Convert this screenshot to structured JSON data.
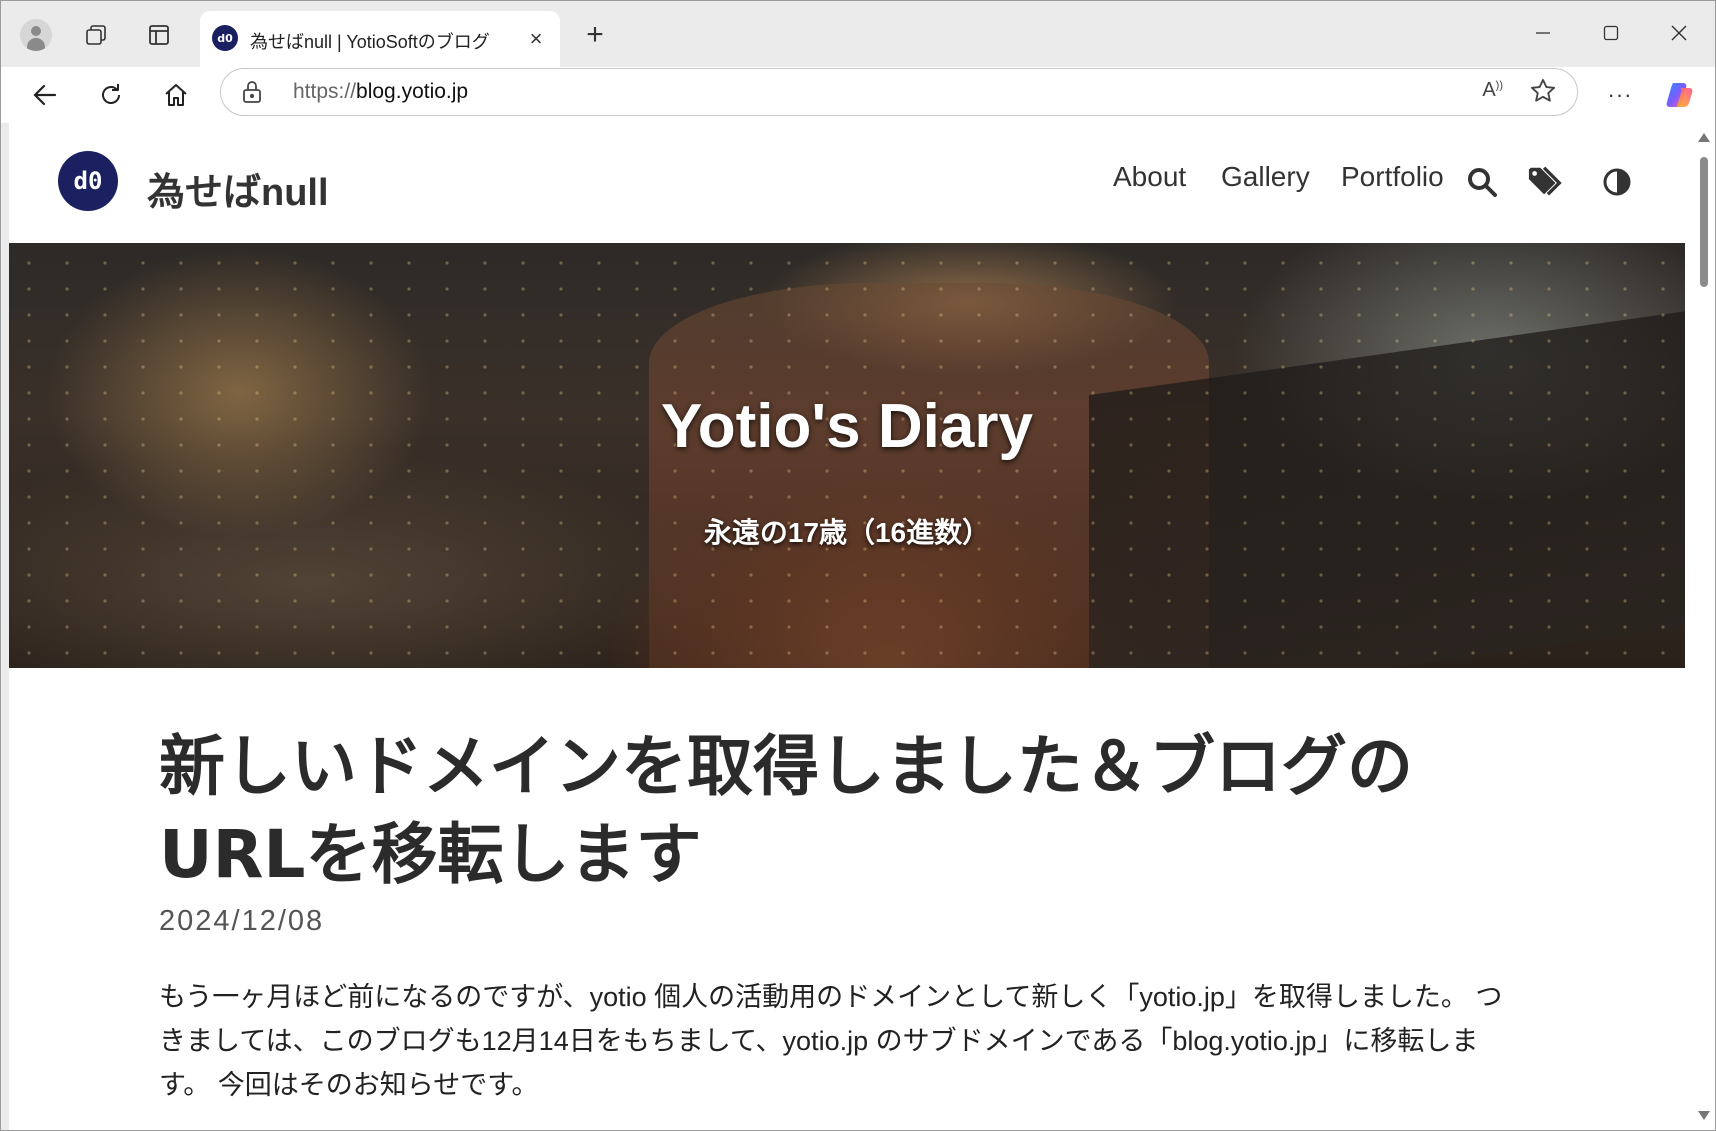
{
  "browser": {
    "tab": {
      "favicon_text": "d0",
      "title": "為せばnull | YotioSoftのブログ",
      "close_glyph": "×"
    },
    "newtab_glyph": "+",
    "address": {
      "scheme": "https://",
      "host": "blog.yotio.jp"
    },
    "read_aloud_glyph": "A",
    "more_glyph": "···"
  },
  "site": {
    "logo_text": "d0",
    "name": "為せばnull",
    "nav": [
      "About",
      "Gallery",
      "Portfolio"
    ]
  },
  "hero": {
    "title": "Yotio's Diary",
    "subtitle": "永遠の17歳（16進数）"
  },
  "post": {
    "title": "新しいドメインを取得しました＆ブログのURLを移転します",
    "date": "2024/12/08",
    "body": "もう一ヶ月ほど前になるのですが、yotio 個人の活動用のドメインとして新しく「yotio.jp」を取得しました。 つきましては、このブログも12月14日をもちまして、yotio.jp のサブドメインである「blog.yotio.jp」に移転します。 今回はそのお知らせです。"
  },
  "colors": {
    "brand_navy": "#1a2060",
    "text_dark": "#2b2b2b"
  }
}
